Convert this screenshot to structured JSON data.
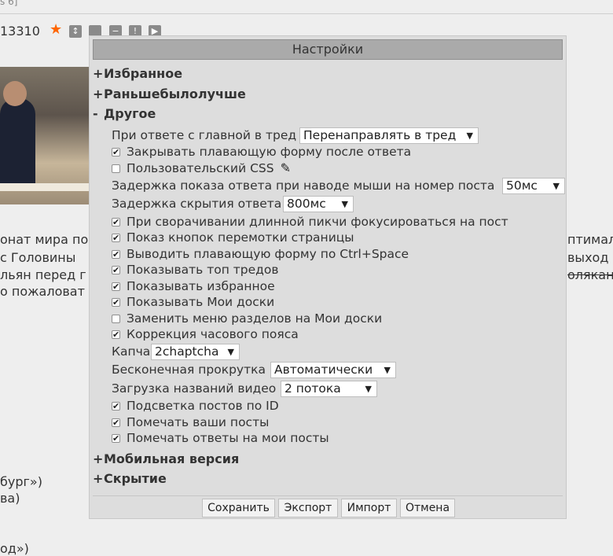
{
  "background": {
    "top_fragment": "s 6]",
    "post_number": "13310",
    "lines": [
      "онат мира по",
      " с Головины",
      "льян перед г",
      "о пожаловат"
    ],
    "right_lines": [
      "птимал",
      "выход",
      "олякан"
    ],
    "bottom_lines": [
      "бург»)",
      "ва)",
      "од»)"
    ]
  },
  "modal": {
    "title": "Настройки",
    "sections": [
      {
        "sign": "+",
        "label": "Избранное"
      },
      {
        "sign": "+",
        "label": "Раньшебылолучше"
      },
      {
        "sign": "-",
        "label": "Другое"
      },
      {
        "sign": "+",
        "label": "Мобильная версия"
      },
      {
        "sign": "+",
        "label": "Скрытие"
      }
    ],
    "other": {
      "reply_main_label": "При ответе с главной в тред",
      "reply_main_value": "Перенаправлять в тред",
      "close_float": "Закрывать плавающую форму после ответа",
      "custom_css": "Пользовательский CSS",
      "hover_delay_label": "Задержка показа ответа при наводе мыши на номер поста",
      "hover_delay_value": "50мс",
      "hide_delay_label": "Задержка скрытия ответа",
      "hide_delay_value": "800мс",
      "focus_post": "При сворачивании длинной пикчи фокусироваться на пост",
      "scroll_buttons": "Показ кнопок перемотки страницы",
      "ctrl_space": "Выводить плавающую форму по Ctrl+Space",
      "top_threads": "Показывать топ тредов",
      "show_fav": "Показывать избранное",
      "show_my_boards": "Показывать Мои доски",
      "replace_menu": "Заменить меню разделов на Мои доски",
      "timezone": "Коррекция часового пояса",
      "captcha_label": "Капча",
      "captcha_value": "2chaptcha",
      "infinite_label": "Бесконечная прокрутка",
      "infinite_value": "Автоматически",
      "video_label": "Загрузка названий видео",
      "video_value": "2 потока",
      "highlight_id": "Подсветка постов по ID",
      "mark_posts": "Помечать ваши посты",
      "mark_replies": "Помечать ответы на мои посты"
    },
    "buttons": {
      "save": "Сохранить",
      "export": "Экспорт",
      "import": "Импорт",
      "cancel": "Отмена"
    }
  },
  "colors": {
    "star": "#ff6600",
    "header_bg": "#aaaaaa",
    "modal_bg": "#dddddd"
  }
}
